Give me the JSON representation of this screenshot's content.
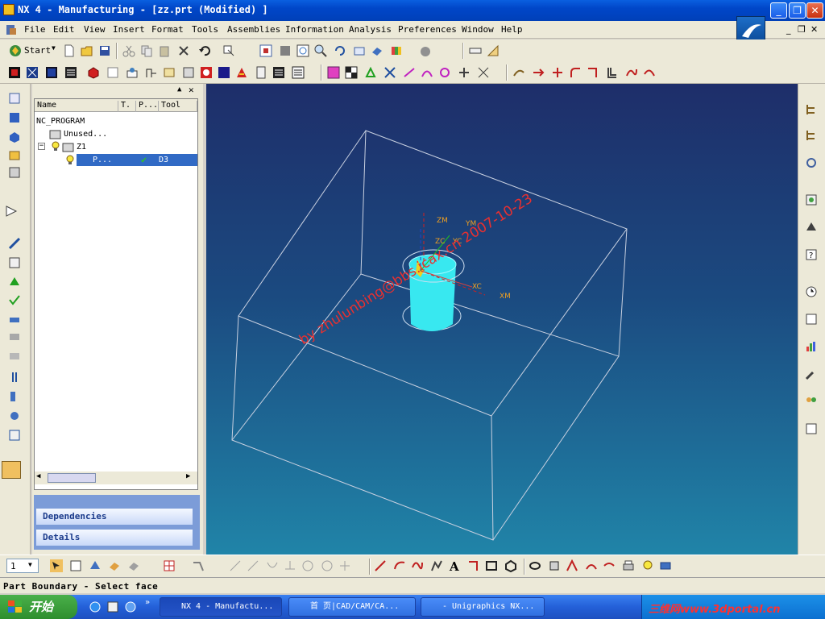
{
  "window": {
    "title": "NX 4 - Manufacturing - [zz.prt (Modified) ]",
    "minimize": "_",
    "maximize": "❐",
    "close": "✕"
  },
  "menu": {
    "items": [
      "File",
      "Edit",
      "View",
      "Insert",
      "Format",
      "Tools",
      "Assemblies",
      "Information",
      "Analysis",
      "Preferences",
      "Window",
      "Help"
    ],
    "doc_buttons": [
      "_",
      "❐",
      "✕"
    ]
  },
  "toolbar": {
    "start_label": "Start"
  },
  "navigator": {
    "columns": [
      "Name",
      "T.",
      "P...",
      "Tool"
    ],
    "nodes": {
      "root": "NC_PROGRAM",
      "unused": "Unused...",
      "z1": "Z1",
      "op_name": "P...",
      "op_tool": "D3"
    },
    "panels": [
      "Dependencies",
      "Details"
    ]
  },
  "viewport": {
    "labels": {
      "zm": "ZM",
      "ym": "YM",
      "zc": "ZC",
      "yc": "YC",
      "xc": "XC",
      "xm": "XM"
    },
    "watermark": "by zhulunbing@bbs.icax.cn 2007-10-23"
  },
  "bottom_toolbar": {
    "layer_select": "1"
  },
  "status": {
    "text": "Part Boundary - Select face"
  },
  "taskbar": {
    "start": "开始",
    "tasks": [
      "NX 4 - Manufactu...",
      "首 页|CAD/CAM/CA...",
      "- Unigraphics NX..."
    ],
    "tray_text": "三维网www.3dportal.cn"
  },
  "colors": {
    "titlebar": "#0046c8",
    "viewport_top": "#1e2e6a",
    "viewport_bottom": "#2084a8",
    "cylinder": "#38e8f0",
    "watermark": "#e83030"
  }
}
